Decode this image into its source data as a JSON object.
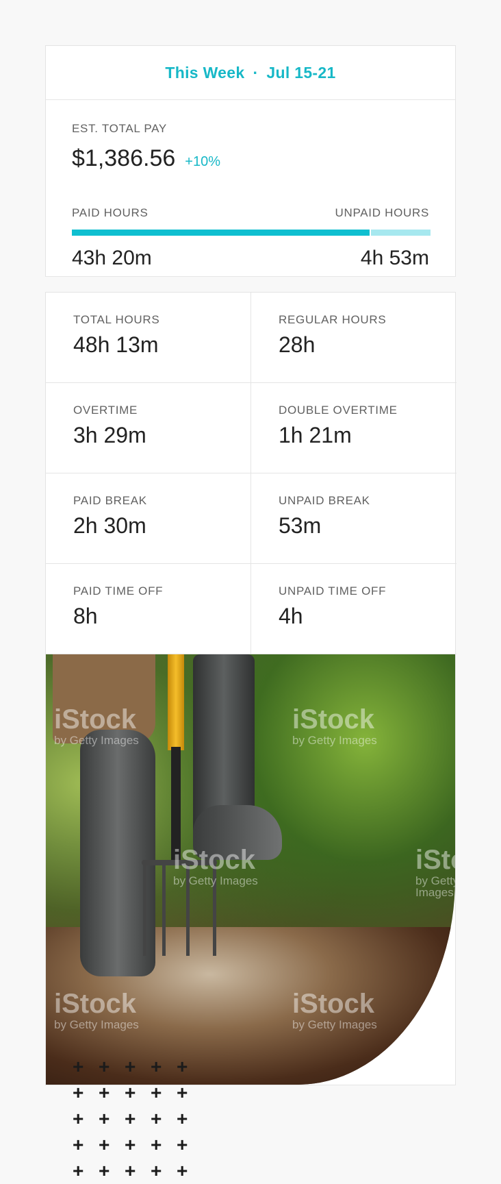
{
  "week": {
    "label": "This Week",
    "separator": "·",
    "range": "Jul 15-21"
  },
  "pay": {
    "label": "EST. TOTAL PAY",
    "amount": "$1,386.56",
    "change": "+10%"
  },
  "hours": {
    "paid_label": "PAID HOURS",
    "unpaid_label": "UNPAID HOURS",
    "paid_value": "43h 20m",
    "unpaid_value": "4h 53m",
    "paid_fraction": 0.83
  },
  "stats": [
    {
      "label": "TOTAL HOURS",
      "value": "48h 13m"
    },
    {
      "label": "REGULAR HOURS",
      "value": "28h"
    },
    {
      "label": "OVERTIME",
      "value": "3h 29m"
    },
    {
      "label": "DOUBLE OVERTIME",
      "value": "1h 21m"
    },
    {
      "label": "PAID BREAK",
      "value": "2h 30m"
    },
    {
      "label": "UNPAID BREAK",
      "value": "53m"
    },
    {
      "label": "PAID TIME OFF",
      "value": "8h"
    },
    {
      "label": "UNPAID TIME OFF",
      "value": "4h"
    }
  ],
  "photo": {
    "watermark_brand": "iStock",
    "watermark_sub": "by Getty Images"
  },
  "decor": {
    "plus_symbol": "+"
  },
  "colors": {
    "accent": "#17b8c7",
    "bar_paid": "#0fbfd0",
    "bar_unpaid": "#a6e8ef"
  }
}
